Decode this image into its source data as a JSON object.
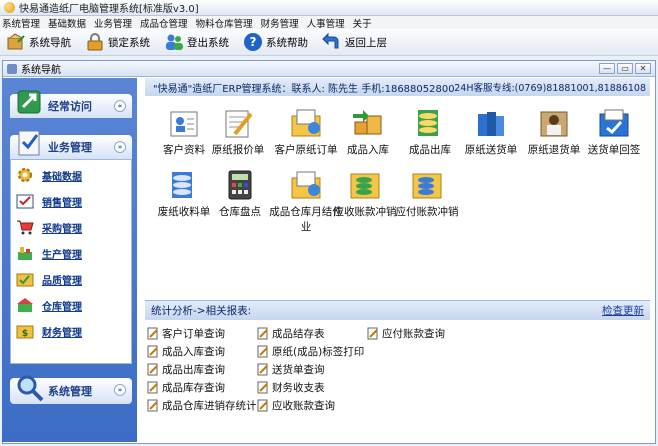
{
  "window": {
    "title": "快易通造纸厂电脑管理系统[标准版v3.0]"
  },
  "menu": [
    "系统管理",
    "基础数据",
    "业务管理",
    "成品仓管理",
    "物料仓库管理",
    "财务管理",
    "人事管理",
    "关于"
  ],
  "toolbar": [
    {
      "label": "系统导航",
      "icon": "navigation-icon"
    },
    {
      "label": "锁定系统",
      "icon": "lock-icon"
    },
    {
      "label": "登出系统",
      "icon": "users-icon"
    },
    {
      "label": "系统帮助",
      "icon": "help-icon"
    },
    {
      "label": "返回上层",
      "icon": "back-arrow-icon"
    }
  ],
  "inner_window": {
    "title": "系统导航",
    "controls": [
      "—",
      "▭",
      "✕"
    ]
  },
  "nav": {
    "groups": [
      {
        "label": "经常访问",
        "chevron": "«"
      },
      {
        "label": "业务管理",
        "chevron": "»"
      },
      {
        "label": "系统管理",
        "chevron": "»"
      }
    ],
    "items": [
      "基础数据",
      "销售管理",
      "采购管理",
      "生产管理",
      "品质管理",
      "仓库管理",
      "财务管理"
    ]
  },
  "header": {
    "info": "\"快易通\"造纸厂ERP管理系统：联系人:  陈先生  手机:18688052800",
    "hotline": "24H客服专线:(0769)81881001,81886108"
  },
  "modules": [
    "客户资料",
    "原纸报价单",
    "客户原纸订单",
    "成品入库",
    "成品出库",
    "原纸送货单",
    "原纸退货单",
    "送货单回签",
    "废纸收料单",
    "仓库盘点",
    "成品仓库月结作业",
    "应收账款冲销",
    "应付账款冲销"
  ],
  "stats": {
    "title": "统计分析->相关报表:",
    "check_update": "检查更新",
    "col1": [
      "客户订单查询",
      "成品入库查询",
      "成品出库查询",
      "成品库存查询",
      "成品仓库进销存统计"
    ],
    "col2": [
      "成品结存表",
      "原纸(成品)标签打印",
      "送货单查询",
      "财务收支表",
      "应收账款查询"
    ],
    "col3": [
      "应付账款查询"
    ]
  },
  "colors": {
    "nav_bg": "#4a78cf",
    "header_bg": "#c6d6ef",
    "link": "#123a8a"
  }
}
